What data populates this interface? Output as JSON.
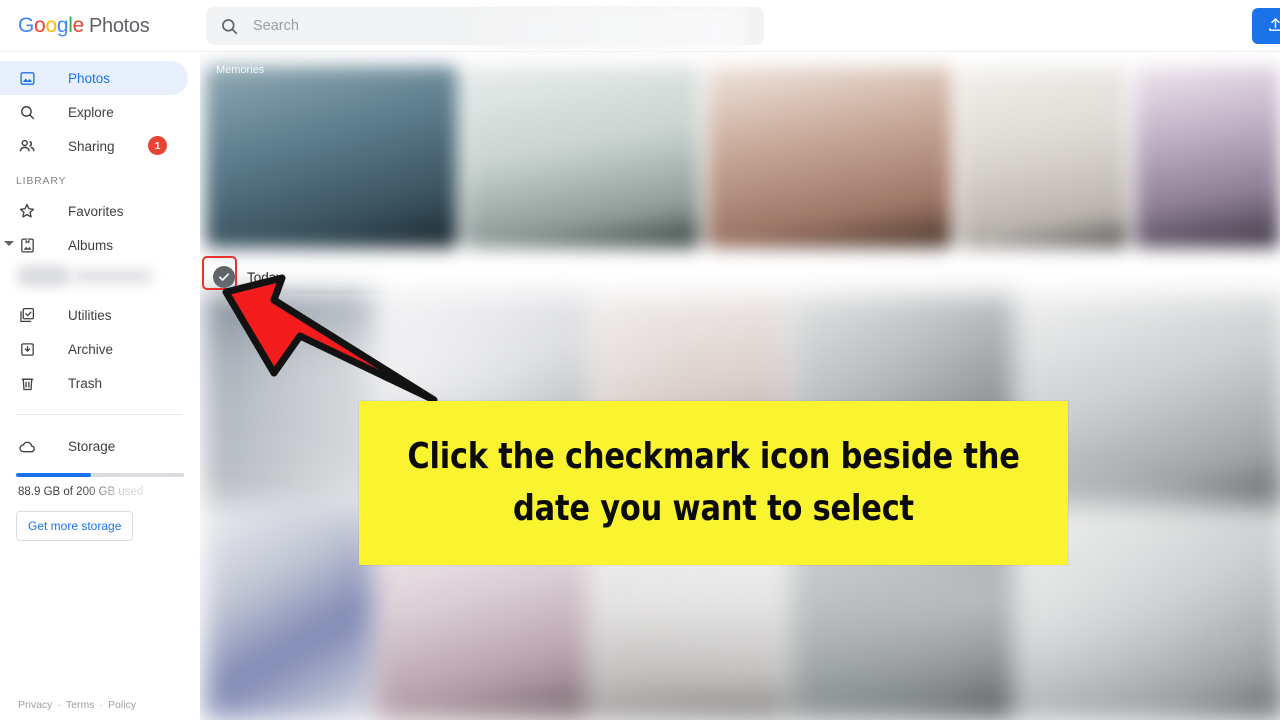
{
  "header": {
    "brand_google": "Google",
    "brand_product": "Photos",
    "search_placeholder": "Search",
    "search_value": "",
    "search_icon": "search-icon",
    "upload_label": "Upload",
    "upload_icon": "upload-icon"
  },
  "sidebar": {
    "items": [
      {
        "label": "Photos",
        "icon": "photo-icon",
        "active": true,
        "badge": null
      },
      {
        "label": "Explore",
        "icon": "search-icon",
        "active": false,
        "badge": null
      },
      {
        "label": "Sharing",
        "icon": "people-icon",
        "active": false,
        "badge": "1"
      }
    ],
    "section_label": "LIBRARY",
    "library_items": [
      {
        "label": "Favorites",
        "icon": "star-icon",
        "active": false,
        "expander": false
      },
      {
        "label": "Albums",
        "icon": "album-icon",
        "active": false,
        "expander": true
      },
      {
        "label": "Utilities",
        "icon": "utilities-icon",
        "active": false,
        "expander": false
      },
      {
        "label": "Archive",
        "icon": "archive-icon",
        "active": false,
        "expander": false
      },
      {
        "label": "Trash",
        "icon": "trash-icon",
        "active": false,
        "expander": false
      }
    ],
    "storage": {
      "label": "Storage",
      "icon": "cloud-icon",
      "usage_text": "88.9 GB of 200 GB used",
      "used_gb": 88.9,
      "total_gb": 200,
      "percent": 44.45,
      "bar_color": "#1a73e8",
      "button_label": "Get more storage"
    },
    "footer": {
      "links": [
        "Privacy",
        "Terms",
        "Policy"
      ],
      "separator": "·"
    }
  },
  "main": {
    "memories_label": "Memories",
    "date_group": {
      "label": "Today",
      "select_icon": "checkmark-circle-icon",
      "selected": true
    }
  },
  "annotations": {
    "arrow": {
      "color": "#f41c1c",
      "outline_color": "#121212",
      "direction": "up-left",
      "points_to": "checkmark-circle-icon"
    },
    "highlight_box": {
      "color": "#e8342a",
      "targets": "checkmark-circle-icon"
    },
    "callout": {
      "background": "#faf430",
      "text_color": "#0b0b0b",
      "text": "Click the checkmark icon beside the date you want to select"
    }
  }
}
